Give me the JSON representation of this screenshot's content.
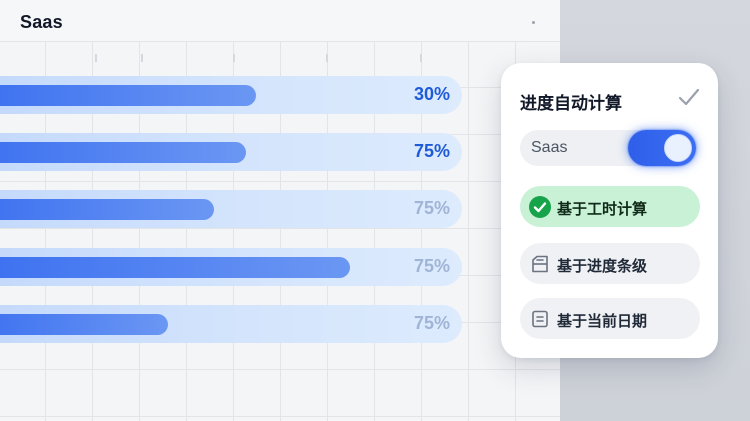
{
  "app": {
    "title": "Saas"
  },
  "progress_rows": [
    {
      "percent_label": "30%",
      "fill": 0.55,
      "emphasis": "strong"
    },
    {
      "percent_label": "75%",
      "fill": 0.53,
      "emphasis": "strong"
    },
    {
      "percent_label": "75%",
      "fill": 0.47,
      "emphasis": "muted"
    },
    {
      "percent_label": "75%",
      "fill": 0.73,
      "emphasis": "muted"
    },
    {
      "percent_label": "75%",
      "fill": 0.38,
      "emphasis": "muted"
    }
  ],
  "panel": {
    "title": "进度自动计算",
    "toggle": {
      "label": "Saas",
      "on": true
    },
    "options": [
      {
        "label": "基于工时计算",
        "selected": true,
        "icon": "check-circle-icon"
      },
      {
        "label": "基于进度条级",
        "selected": false,
        "icon": "progress-doc-icon"
      },
      {
        "label": "基于当前日期",
        "selected": false,
        "icon": "date-doc-icon"
      }
    ]
  },
  "colors": {
    "accent": "#3b6ff0",
    "selected_bg": "#c9f1d6",
    "check_green": "#16a34a"
  }
}
